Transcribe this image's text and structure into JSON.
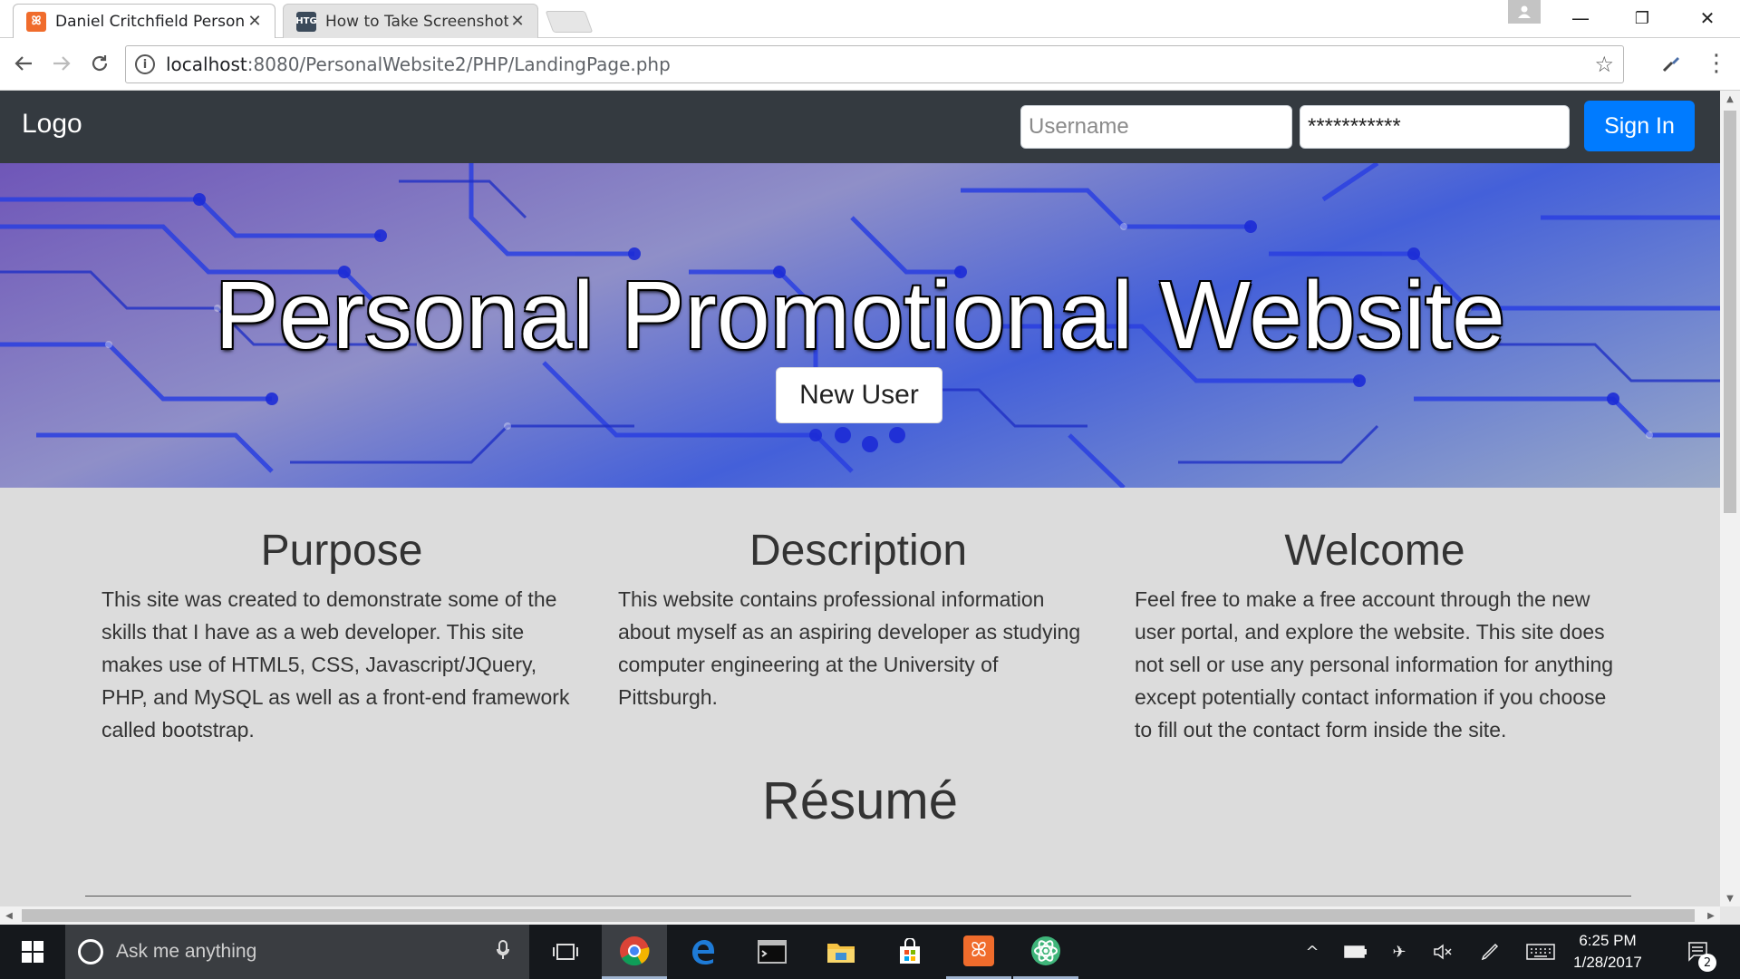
{
  "browser": {
    "tabs": [
      {
        "title": "Daniel Critchfield Persona",
        "favicon": "xampp-icon",
        "active": true
      },
      {
        "title": "How to Take Screenshots",
        "favicon": "htg-icon",
        "active": false
      }
    ],
    "favicon_text": {
      "htg": "HTG"
    },
    "close_glyph": "✕",
    "window_controls": {
      "minimize": "—",
      "restore": "❐",
      "close": "✕"
    },
    "address": {
      "host": "localhost",
      "path": ":8080/PersonalWebsite2/PHP/LandingPage.php"
    }
  },
  "site": {
    "logo": "Logo",
    "username_placeholder": "Username",
    "password_value": "***********",
    "signin_label": "Sign In",
    "hero_title": "Personal Promotional Website",
    "new_user_label": "New User",
    "sections": [
      {
        "title": "Purpose",
        "text": "This site was created to demonstrate some of the skills that I have as a web developer. This site makes use of HTML5, CSS, Javascript/JQuery, PHP, and MySQL as well as a front-end framework called bootstrap."
      },
      {
        "title": "Description",
        "text": "This website contains professional information about myself as an aspiring developer as studying computer engineering at the University of Pittsburgh."
      },
      {
        "title": "Welcome",
        "text": "Feel free to make a free account through the new user portal, and explore the website. This site does not sell or use any personal information for anything except potentially contact information if you choose to fill out the contact form inside the site."
      }
    ],
    "resume_title": "Résumé"
  },
  "taskbar": {
    "search_placeholder": "Ask me anything",
    "time": "6:25 PM",
    "date": "1/28/2017",
    "notification_count": "2",
    "xampp_glyph": "ꕤ"
  },
  "colors": {
    "navbar": "#343a40",
    "accent": "#007bff",
    "page_bg": "#dcdcdc",
    "taskbar": "#15181c"
  }
}
